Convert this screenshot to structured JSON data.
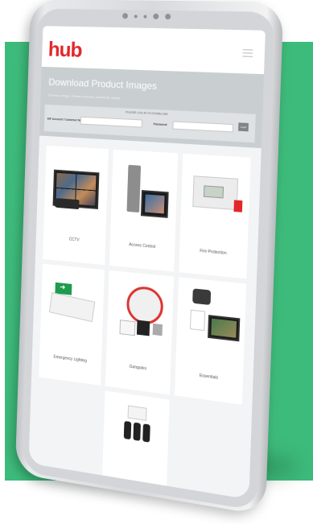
{
  "brand": {
    "logo_text": "hub",
    "logo_small": "",
    "accent_color": "#e3262a",
    "background_color": "#3dbb7a"
  },
  "hero": {
    "title": "Download Product Images",
    "subtitle": "Choose a range, choose a product, download, simple."
  },
  "login": {
    "heading": "PLEASE LOG IN TO DOWNLOAD",
    "account_label": "EIF Account / Customer No:",
    "password_label": "Password:",
    "button_label": "Login"
  },
  "categories": [
    {
      "label": "CCTV",
      "icon": "cctv-icon"
    },
    {
      "label": "Access Control",
      "icon": "access-control-icon"
    },
    {
      "label": "Fire Protection",
      "icon": "fire-panel-icon"
    },
    {
      "label": "Emergency Lighting",
      "icon": "emergency-light-icon"
    },
    {
      "label": "Gangutes",
      "icon": "gangutes-icon"
    },
    {
      "label": "Essentials",
      "icon": "essentials-icon"
    },
    {
      "label": "",
      "icon": "remote-fob-icon"
    }
  ]
}
